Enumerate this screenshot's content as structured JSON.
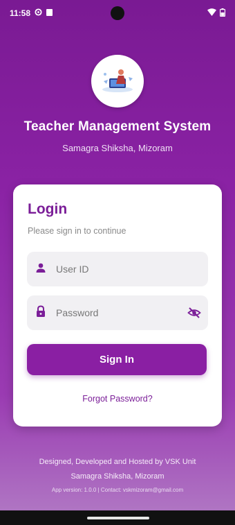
{
  "status_bar": {
    "time": "11:58"
  },
  "header": {
    "title": "Teacher Management System",
    "subtitle": "Samagra Shiksha, Mizoram"
  },
  "login": {
    "heading": "Login",
    "subheading": "Please sign in to continue",
    "user_id_placeholder": "User ID",
    "password_placeholder": "Password",
    "sign_in_label": "Sign In",
    "forgot_label": "Forgot Password?"
  },
  "footer": {
    "line1": "Designed, Developed and Hosted by VSK Unit",
    "line2": "Samagra Shiksha, Mizoram",
    "line3": "App version: 1.0.0 | Contact: vskmizoram@gmail.com"
  },
  "colors": {
    "primary": "#8a1fa3",
    "gradient_top": "#7a1a93",
    "gradient_bottom": "#b27cc5"
  },
  "icons": [
    "settings-icon",
    "sim-icon",
    "wifi-icon",
    "battery-icon",
    "person-icon",
    "lock-icon",
    "eye-off-icon",
    "app-logo"
  ]
}
